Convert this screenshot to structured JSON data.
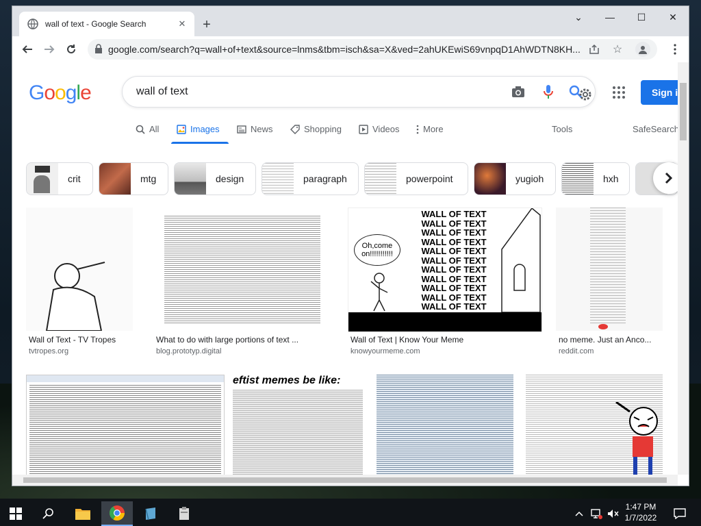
{
  "tab": {
    "title": "wall of text - Google Search"
  },
  "window_controls": {
    "minimize": "—",
    "maximize": "☐",
    "close": "✕",
    "chevron": "⌄"
  },
  "toolbar": {
    "url": "google.com/search?q=wall+of+text&source=lnms&tbm=isch&sa=X&ved=2ahUKEwiS69vnpqD1AhWDTN8KH..."
  },
  "search": {
    "query": "wall of text",
    "signin_label": "Sign i"
  },
  "search_tabs": [
    {
      "label": "All",
      "icon": "search-icon"
    },
    {
      "label": "Images",
      "icon": "image-icon"
    },
    {
      "label": "News",
      "icon": "news-icon"
    },
    {
      "label": "Shopping",
      "icon": "tag-icon"
    },
    {
      "label": "Videos",
      "icon": "play-icon"
    },
    {
      "label": "More",
      "icon": "more-vert-icon"
    }
  ],
  "tools_label": "Tools",
  "safesearch_label": "SafeSearch",
  "chips": [
    "crit",
    "mtg",
    "design",
    "paragraph",
    "powerpoint",
    "yugioh",
    "hxh"
  ],
  "results_row1": [
    {
      "title": "Wall of Text - TV Tropes",
      "source": "tvtropes.org"
    },
    {
      "title": "What to do with large portions of text ...",
      "source": "blog.prototyp.digital"
    },
    {
      "title": "Wall of Text | Know Your Meme",
      "source": "knowyourmeme.com"
    },
    {
      "title": "no meme. Just an Anco...",
      "source": "reddit.com"
    }
  ],
  "meme": {
    "speech": "Oh,come on!!!!!!!!!!!",
    "wall_lines": [
      "WALL OF TEXT",
      "WALL OF TEXT",
      "WALL OF TEXT",
      "WALL OF TEXT",
      "WALL OF TEXT",
      "WALL OF TEXT",
      "WALL OF TEXT",
      "WALL OF TEXT",
      "WALL OF TEXT",
      "WALL OF TEXT",
      "WALL OF TEXT"
    ]
  },
  "results_row2": [
    {
      "title": ""
    },
    {
      "title": "",
      "caption": "eftist memes be like:"
    },
    {
      "title": ""
    },
    {
      "title": ""
    }
  ],
  "taskbar": {
    "time": "1:47 PM",
    "date": "1/7/2022"
  },
  "colors": {
    "accent": "#1a73e8"
  }
}
